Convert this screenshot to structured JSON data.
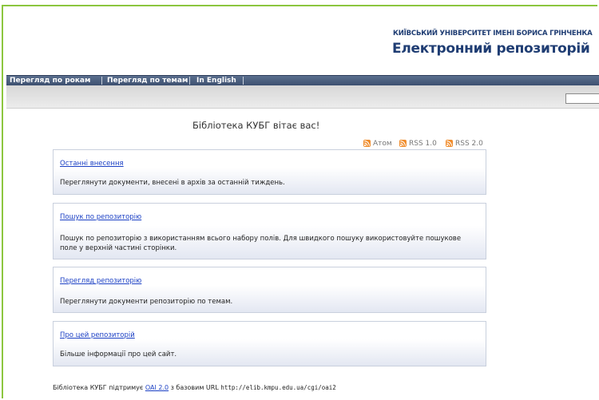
{
  "header": {
    "university": "КИЇВСЬКИЙ УНІВЕРСИТЕТ ІМЕНІ БОРИСА ГРІНЧЕНКА",
    "repository_title": "Електронний репозиторій"
  },
  "nav": {
    "items": [
      {
        "label": "Перегляд по рокам"
      },
      {
        "label": "Перегляд по темам"
      },
      {
        "label": "In English"
      }
    ]
  },
  "main": {
    "welcome": "Бібліотека КУБГ вітає вас!",
    "feeds": [
      {
        "label": "Атом",
        "icon": "rss-icon"
      },
      {
        "label": "RSS 1.0",
        "icon": "rss-icon"
      },
      {
        "label": "RSS 2.0",
        "icon": "rss-icon"
      }
    ],
    "cards": [
      {
        "link": "Останні внесення",
        "description": "Переглянути документи, внесені в архів за останній тиждень."
      },
      {
        "link": "Пошук по репозиторію",
        "description": "Пошук по репозиторію з використанням всього набору полів. Для швидкого пошуку використовуйте пошукове поле у верхній частині сторінки."
      },
      {
        "link": "Перегляд репозиторію",
        "description": "Переглянути документи репозиторію по темам."
      },
      {
        "link": "Про цей репозиторій",
        "description": "Більше інформації про цей сайт."
      }
    ]
  },
  "footer": {
    "prefix": "Бібліотека КУБГ підтримує ",
    "oai_link": "OAI 2.0",
    "middle": " з базовим URL ",
    "url": "http://elib.kmpu.edu.ua/cgi/oai2"
  },
  "colors": {
    "frame": "#8cc63f",
    "title": "#1f3d73",
    "navbar": "#4a5d7e",
    "link": "#1a3fc4",
    "rss": "#f08c2c"
  }
}
